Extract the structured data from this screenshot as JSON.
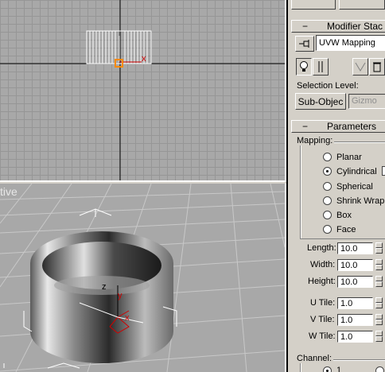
{
  "viewports": {
    "perspective_label": "tive"
  },
  "modifier_stack": {
    "title": "Modifier Stac",
    "current_modifier": "UVW Mapping",
    "selection_level_label": "Selection Level:",
    "sub_object_button": "Sub-Objec",
    "gizmo_field": "Gizmo"
  },
  "parameters": {
    "title": "Parameters",
    "mapping_label": "Mapping:",
    "mapping_options": [
      {
        "label": "Planar",
        "selected": false
      },
      {
        "label": "Cylindrical",
        "selected": true
      },
      {
        "label": "Spherical",
        "selected": false
      },
      {
        "label": "Shrink Wrap",
        "selected": false
      },
      {
        "label": "Box",
        "selected": false
      },
      {
        "label": "Face",
        "selected": false
      }
    ],
    "length_label": "Length:",
    "length_value": "10.0",
    "width_label": "Width:",
    "width_value": "10.0",
    "height_label": "Height:",
    "height_value": "10.0",
    "u_tile_label": "U Tile:",
    "u_tile_value": "1.0",
    "v_tile_label": "V Tile:",
    "v_tile_value": "1.0",
    "w_tile_label": "W Tile:",
    "w_tile_value": "1.0",
    "channel_label": "Channel:",
    "channel_value": "1"
  },
  "gizmo_axes": {
    "x": "x",
    "y": "y",
    "z": "z"
  },
  "colors": {
    "viewport_bg": "#a8a8a8",
    "grid": "#969696",
    "panel_bg": "#d4d0c8",
    "axis_red": "#d00000",
    "gizmo_orange": "#ff8a00"
  }
}
